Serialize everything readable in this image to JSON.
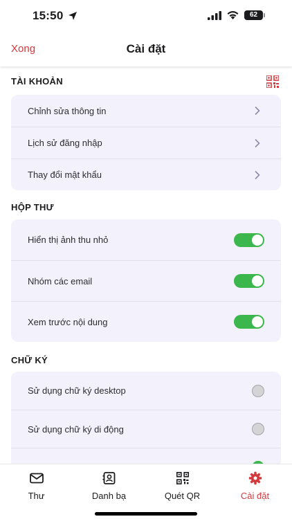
{
  "status_bar": {
    "time": "15:50",
    "battery": "62"
  },
  "nav": {
    "done_label": "Xong",
    "title": "Cài đặt"
  },
  "account": {
    "header": "TÀI KHOẢN",
    "items": [
      {
        "label": "Chỉnh sửa thông tin"
      },
      {
        "label": "Lịch sử đăng nhập"
      },
      {
        "label": "Thay đổi mật khẩu"
      }
    ]
  },
  "mailbox": {
    "header": "HỘP THƯ",
    "items": [
      {
        "label": "Hiển thị ảnh thu nhỏ",
        "on": true
      },
      {
        "label": "Nhóm các email",
        "on": true
      },
      {
        "label": "Xem trước nội dung",
        "on": true
      }
    ]
  },
  "signature": {
    "header": "CHỮ KÝ",
    "items": [
      {
        "label": "Sử dụng chữ ký desktop",
        "selected": false
      },
      {
        "label": "Sử dụng chữ ký di động",
        "selected": false
      },
      {
        "label": "",
        "selected": true
      }
    ]
  },
  "tabs": [
    {
      "label": "Thư",
      "icon": "mail-icon",
      "active": false
    },
    {
      "label": "Danh bạ",
      "icon": "contacts-icon",
      "active": false
    },
    {
      "label": "Quét QR",
      "icon": "qr-icon",
      "active": false
    },
    {
      "label": "Cài đặt",
      "icon": "gear-icon",
      "active": true
    }
  ],
  "colors": {
    "accent": "#d2383c",
    "toggle_on": "#3bb74d",
    "group_bg": "#f3f1fb"
  }
}
